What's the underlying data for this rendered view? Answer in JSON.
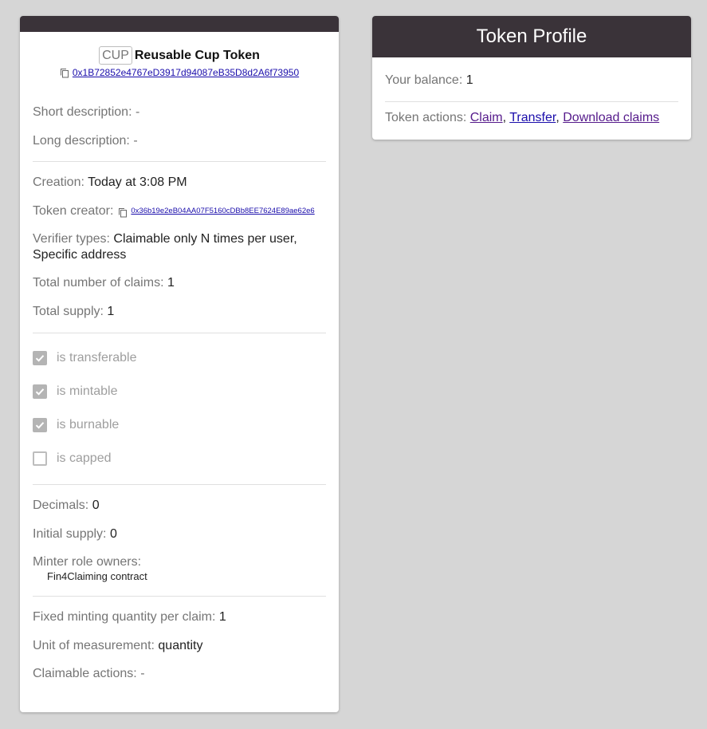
{
  "token": {
    "symbol": "CUP",
    "name": "Reusable Cup Token",
    "address": "0x1B72852e4767eD3917d94087eB35D8d2A6f73950"
  },
  "details": {
    "short_description": {
      "label": "Short description:",
      "value": "-"
    },
    "long_description": {
      "label": "Long description:",
      "value": "-"
    },
    "creation": {
      "label": "Creation:",
      "value": "Today at 3:08 PM"
    },
    "token_creator": {
      "label": "Token creator:",
      "value": "0x36b19e2eB04AA07F5160cDBb8EE7624E89ae62e6"
    },
    "verifier_types": {
      "label": "Verifier types:",
      "value": "Claimable only N times per user, Specific address"
    },
    "total_claims": {
      "label": "Total number of claims:",
      "value": "1"
    },
    "total_supply": {
      "label": "Total supply:",
      "value": "1"
    }
  },
  "properties": [
    {
      "label": "is transferable",
      "checked": true
    },
    {
      "label": "is mintable",
      "checked": true
    },
    {
      "label": "is burnable",
      "checked": true
    },
    {
      "label": "is capped",
      "checked": false
    }
  ],
  "more": {
    "decimals": {
      "label": "Decimals:",
      "value": "0"
    },
    "initial_supply": {
      "label": "Initial supply:",
      "value": "0"
    },
    "minter_roles": {
      "label": "Minter role owners:",
      "value": "Fin4Claiming contract"
    }
  },
  "claiming": {
    "fixed_quantity": {
      "label": "Fixed minting quantity per claim:",
      "value": "1"
    },
    "unit": {
      "label": "Unit of measurement:",
      "value": "quantity"
    },
    "claimable_actions": {
      "label": "Claimable actions:",
      "value": "-"
    }
  },
  "profile": {
    "title": "Token Profile",
    "balance_label": "Your balance:",
    "balance_value": "1",
    "actions_label": "Token actions:",
    "actions": {
      "claim": "Claim",
      "transfer": "Transfer",
      "download": "Download claims"
    },
    "separator": ","
  },
  "colors": {
    "header_bg": "#3a3339",
    "page_bg": "#d6d6d6",
    "link": "#1a0dab",
    "visited_link": "#551a8b"
  },
  "icons": {
    "copy": "copy-icon",
    "check": "check-icon"
  }
}
